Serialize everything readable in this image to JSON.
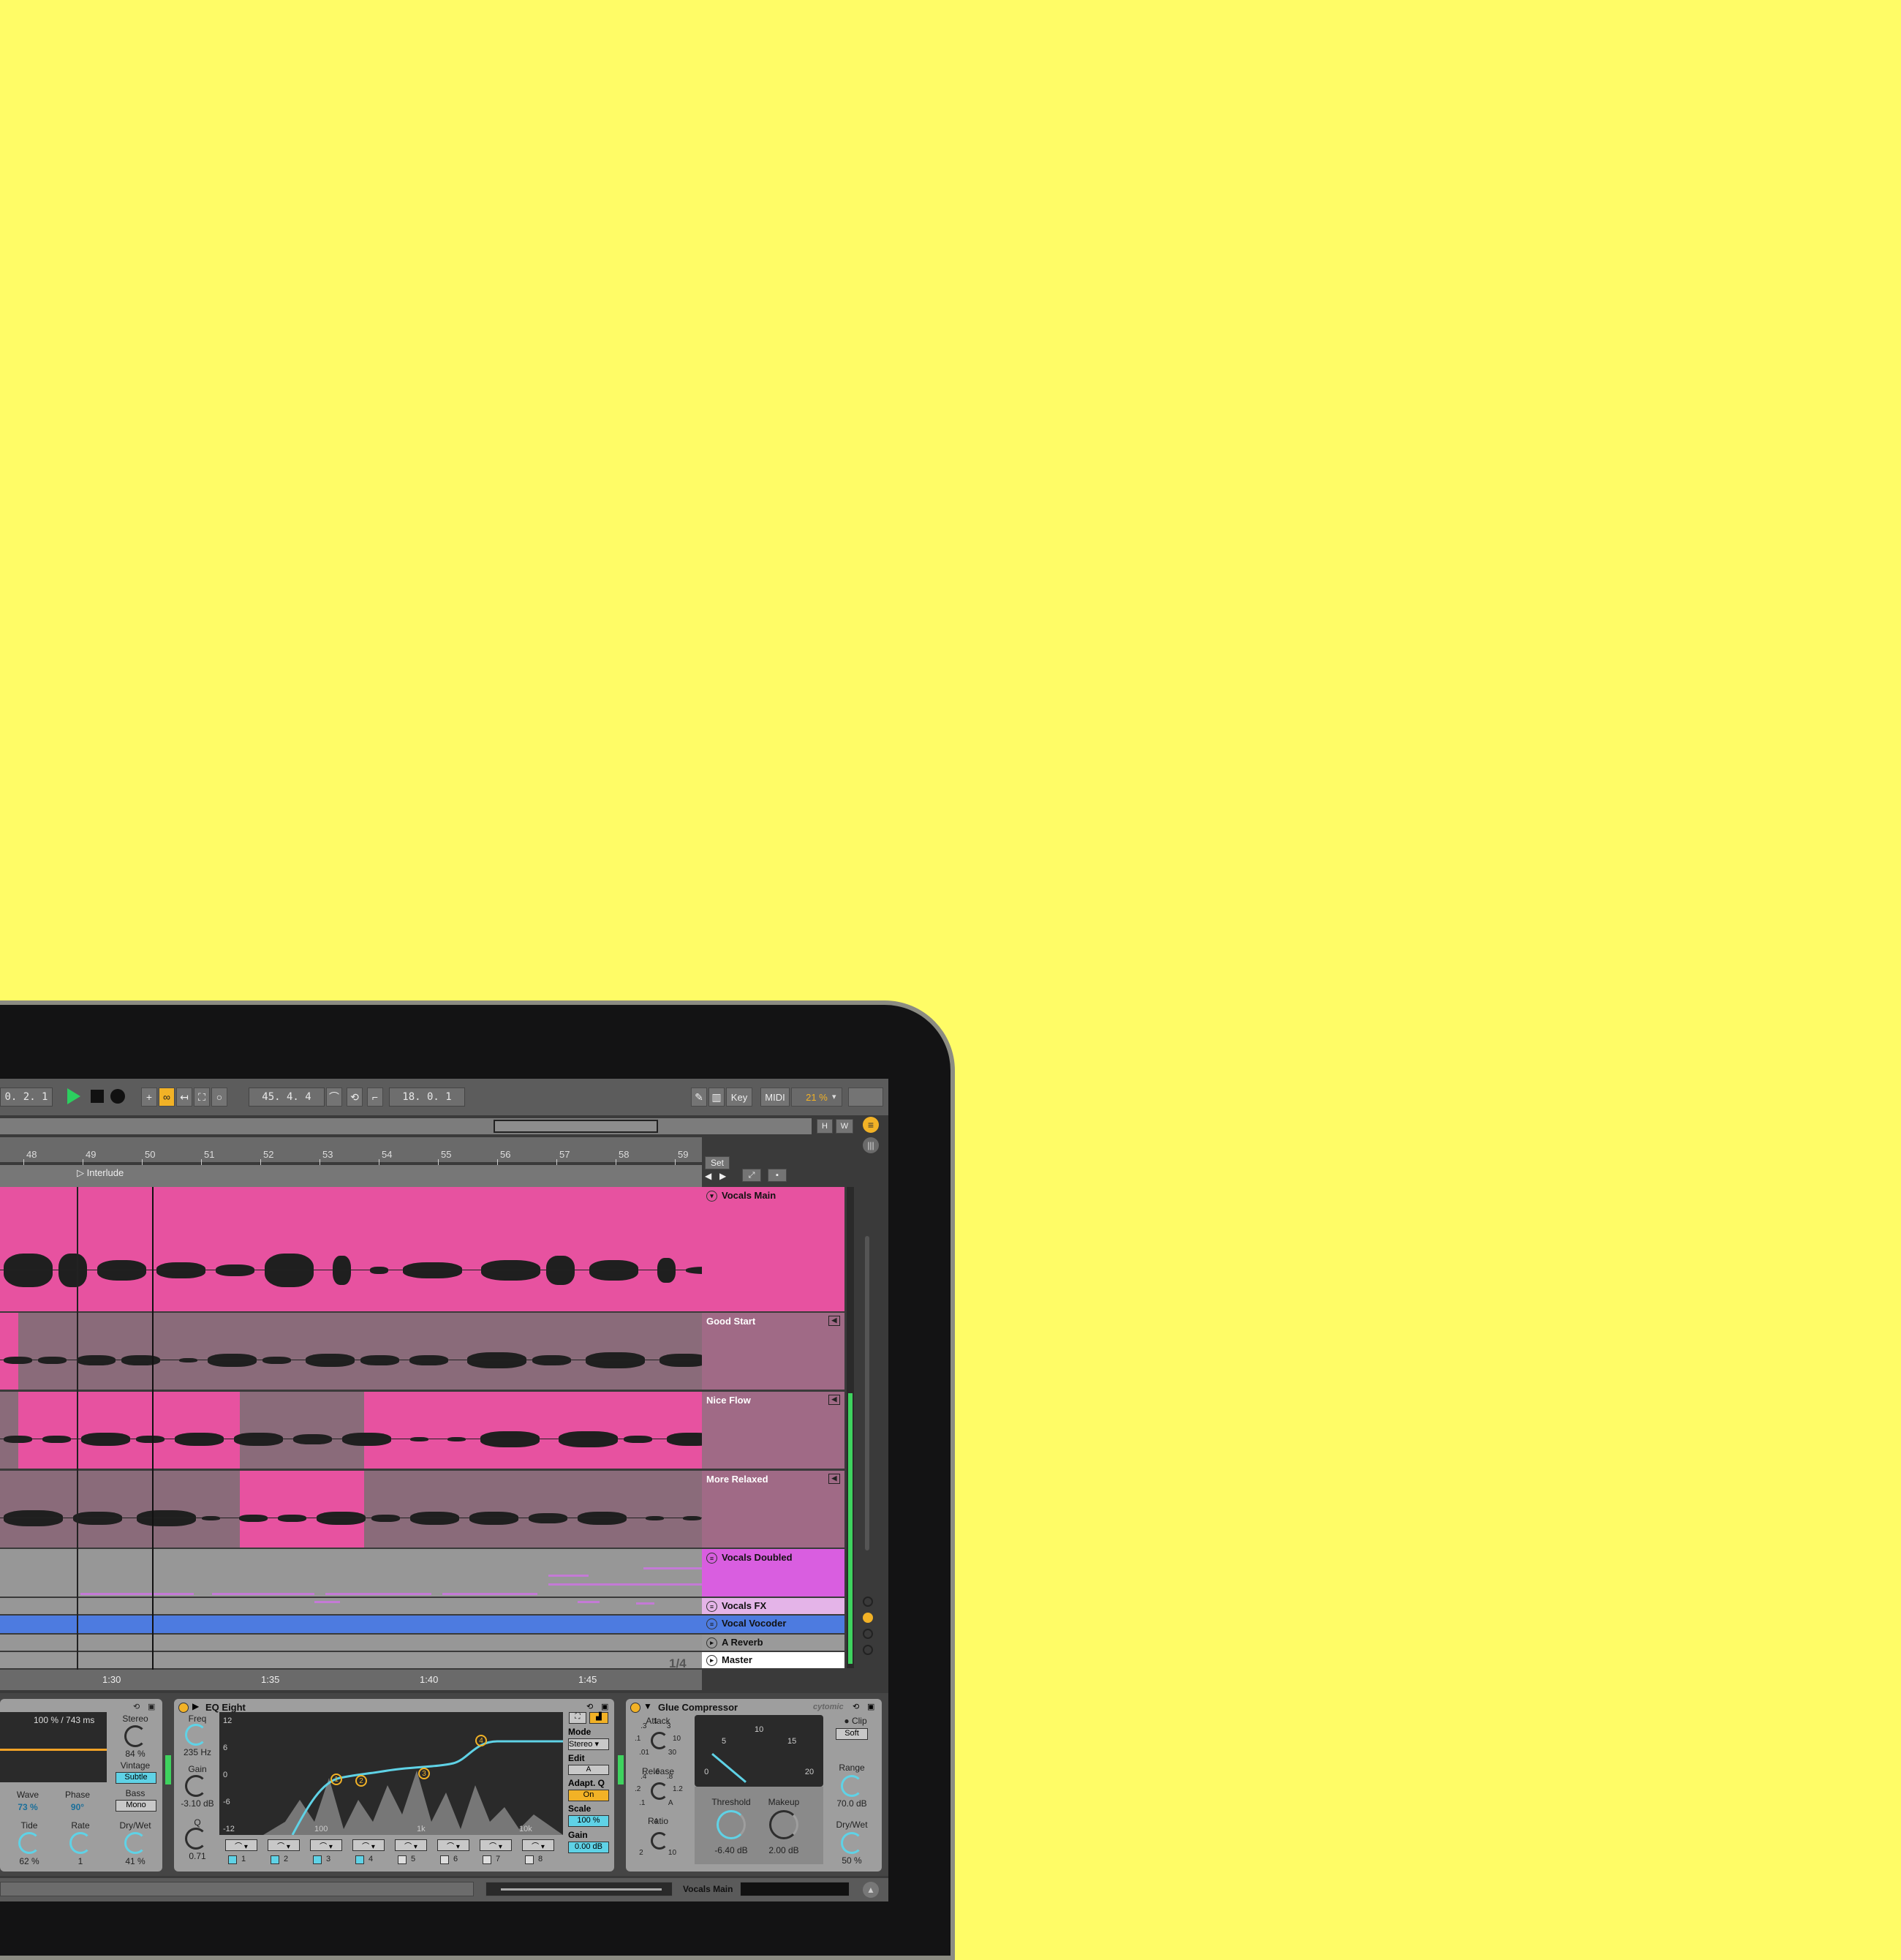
{
  "colors": {
    "background": "#fffc66",
    "accent": "#f2b226",
    "clip": "#e752a0",
    "clip_inactive": "#8a6b7a",
    "play": "#2ccf5f"
  },
  "transport": {
    "position_left": "0.  2.  1",
    "arrangement_position": "45.  4.  4",
    "loop_length": "18.  0.  1",
    "key_label": "Key",
    "midi_label": "MIDI",
    "cpu": "21 %"
  },
  "overview": {
    "h_label": "H",
    "w_label": "W"
  },
  "ruler": {
    "bars": [
      "48",
      "49",
      "50",
      "51",
      "52",
      "53",
      "54",
      "55",
      "56",
      "57",
      "58",
      "59"
    ],
    "times": [
      "1:30",
      "1:35",
      "1:40",
      "1:45"
    ]
  },
  "locator": {
    "label": "Interlude",
    "set_label": "Set"
  },
  "tracks": [
    {
      "name": "Vocals Main",
      "icon": "fold-icon"
    },
    {
      "name": "Good Start",
      "icon": "speaker-icon"
    },
    {
      "name": "Nice Flow",
      "icon": "speaker-icon"
    },
    {
      "name": "More Relaxed",
      "icon": "speaker-icon"
    },
    {
      "name": "Vocals Doubled",
      "icon": "group-icon"
    },
    {
      "name": "Vocals FX",
      "icon": "group-icon"
    },
    {
      "name": "Vocal Vocoder",
      "icon": "group-icon"
    },
    {
      "name": "A Reverb",
      "icon": "play-icon"
    },
    {
      "name": "Master",
      "icon": "play-icon"
    }
  ],
  "zoom_ratio": "1/4",
  "chorus_device": {
    "delay_readout": "100 % / 743 ms",
    "stereo_label": "Stereo",
    "stereo_value": "84 %",
    "vintage_label": "Vintage",
    "vintage_value": "Subtle",
    "bass_label": "Bass",
    "bass_value": "Mono",
    "wave_label": "Wave",
    "wave_value": "73 %",
    "phase_label": "Phase",
    "phase_value": "90°",
    "tide_label": "Tide",
    "tide_value": "62 %",
    "rate_label": "Rate",
    "rate_value": "1",
    "drywet_label": "Dry/Wet",
    "drywet_value": "41 %"
  },
  "eq": {
    "title": "EQ Eight",
    "freq_label": "Freq",
    "freq_value": "235 Hz",
    "gain_label": "Gain",
    "gain_value": "-3.10 dB",
    "q_label": "Q",
    "q_value": "0.71",
    "db_ticks": [
      "12",
      "6",
      "0",
      "-6",
      "-12"
    ],
    "freq_ticks": [
      "100",
      "1k",
      "10k"
    ],
    "mode_label": "Mode",
    "mode_value": "Stereo",
    "edit_label": "Edit",
    "edit_value": "A",
    "adaptq_label": "Adapt. Q",
    "adaptq_value": "On",
    "scale_label": "Scale",
    "scale_value": "100 %",
    "outgain_label": "Gain",
    "outgain_value": "0.00 dB",
    "bands": [
      "1",
      "2",
      "3",
      "4",
      "5",
      "6",
      "7",
      "8"
    ],
    "nodes": [
      "1",
      "2",
      "3",
      "4"
    ]
  },
  "glue": {
    "title": "Glue Compressor",
    "brand": "cytomic",
    "attack_label": "Attack",
    "attack_ticks": [
      ".01",
      ".1",
      ".3",
      "1",
      "3",
      "10",
      "30"
    ],
    "release_label": "Release",
    "release_ticks": [
      ".1",
      ".2",
      ".4",
      ".6",
      ".8",
      "1.2",
      "A"
    ],
    "ratio_label": "Ratio",
    "ratio_ticks": [
      "2",
      "4",
      "10"
    ],
    "meter_ticks": [
      "0",
      "5",
      "10",
      "15",
      "20"
    ],
    "threshold_label": "Threshold",
    "threshold_value": "-6.40 dB",
    "makeup_label": "Makeup",
    "makeup_value": "2.00 dB",
    "clip_label": "Clip",
    "clip_value": "Soft",
    "range_label": "Range",
    "range_value": "70.0 dB",
    "drywet_label": "Dry/Wet",
    "drywet_value": "50 %"
  },
  "status": {
    "track_name": "Vocals Main"
  }
}
